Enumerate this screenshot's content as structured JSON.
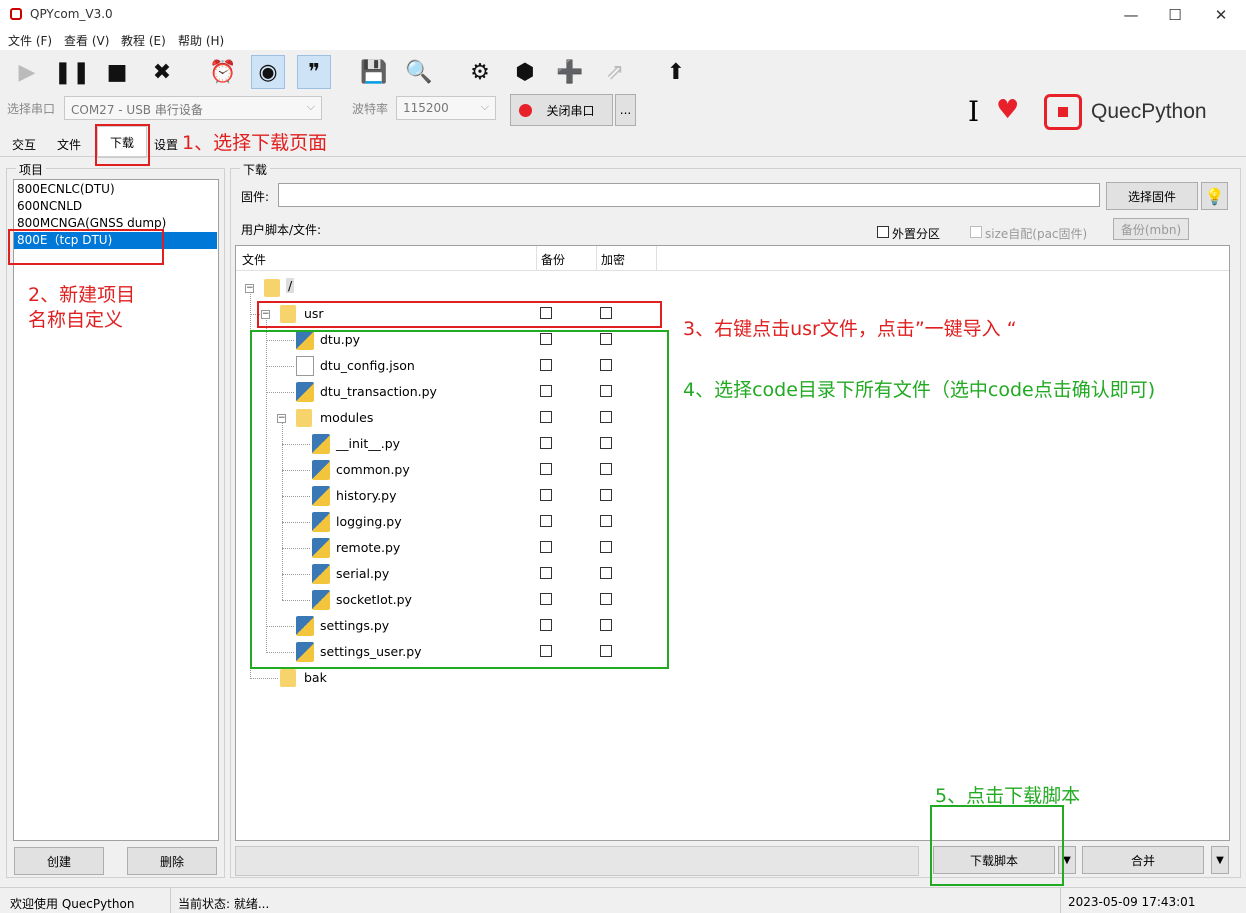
{
  "window": {
    "title": "QPYcom_V3.0",
    "minimize": "—",
    "maximize": "☐",
    "close": "✕"
  },
  "menu": [
    "文件 (F)",
    "查看 (V)",
    "教程 (E)",
    "帮助 (H)"
  ],
  "connection": {
    "port_label": "选择串口",
    "port_value": "COM27 - USB 串行设备",
    "baud_label": "波特率",
    "baud_value": "115200",
    "close_port_button": "关闭串口",
    "more_button": "..."
  },
  "brand": {
    "cursor": "I",
    "name": "QuecPython"
  },
  "tabs": [
    "交互",
    "文件",
    "下载",
    "设置"
  ],
  "project_panel": {
    "group_label": "项目",
    "items": [
      "800ECNLC(DTU)",
      "600NCNLD",
      "800MCNGA(GNSS dump)",
      "800E（tcp DTU)"
    ],
    "selected_index": 3,
    "create_button": "创建",
    "delete_button": "删除"
  },
  "download_panel": {
    "group_label": "下载",
    "firmware_label": "固件:",
    "firmware_value": "",
    "select_firmware_button": "选择固件",
    "user_script_label": "用户脚本/文件:",
    "external_partition_label": "外置分区",
    "size_adaptive_label": "size自配(pac固件)",
    "backup_mbn_button": "备份(mbn)",
    "columns": [
      "文件",
      "备份",
      "加密"
    ],
    "root": "/",
    "usr_folder": "usr",
    "files": [
      "dtu.py",
      "dtu_config.json",
      "dtu_transaction.py"
    ],
    "modules_folder": "modules",
    "module_files": [
      "__init__.py",
      "common.py",
      "history.py",
      "logging.py",
      "remote.py",
      "serial.py",
      "socketIot.py"
    ],
    "more_files": [
      "settings.py",
      "settings_user.py"
    ],
    "bak_folder": "bak",
    "download_script_button": "下载脚本",
    "merge_button": "合并",
    "dropdown_arrow": "▼"
  },
  "annotations": {
    "step1": "1、选择下载页面",
    "step2_line1": "2、新建项目",
    "step2_line2": "名称自定义",
    "step3": "3、右键点击usr文件，点击”一键导入 “",
    "step4": "4、选择code目录下所有文件（选中code点击确认即可)",
    "step5": "5、点击下载脚本"
  },
  "status": {
    "welcome": "欢迎使用 QuecPython",
    "state": "当前状态: 就绪...",
    "datetime": "2023-05-09 17:43:01"
  },
  "colors": {
    "accent": "#0078d7",
    "annotation_red": "#e02020",
    "annotation_green": "#22aa22",
    "heart": "#e8202a"
  }
}
